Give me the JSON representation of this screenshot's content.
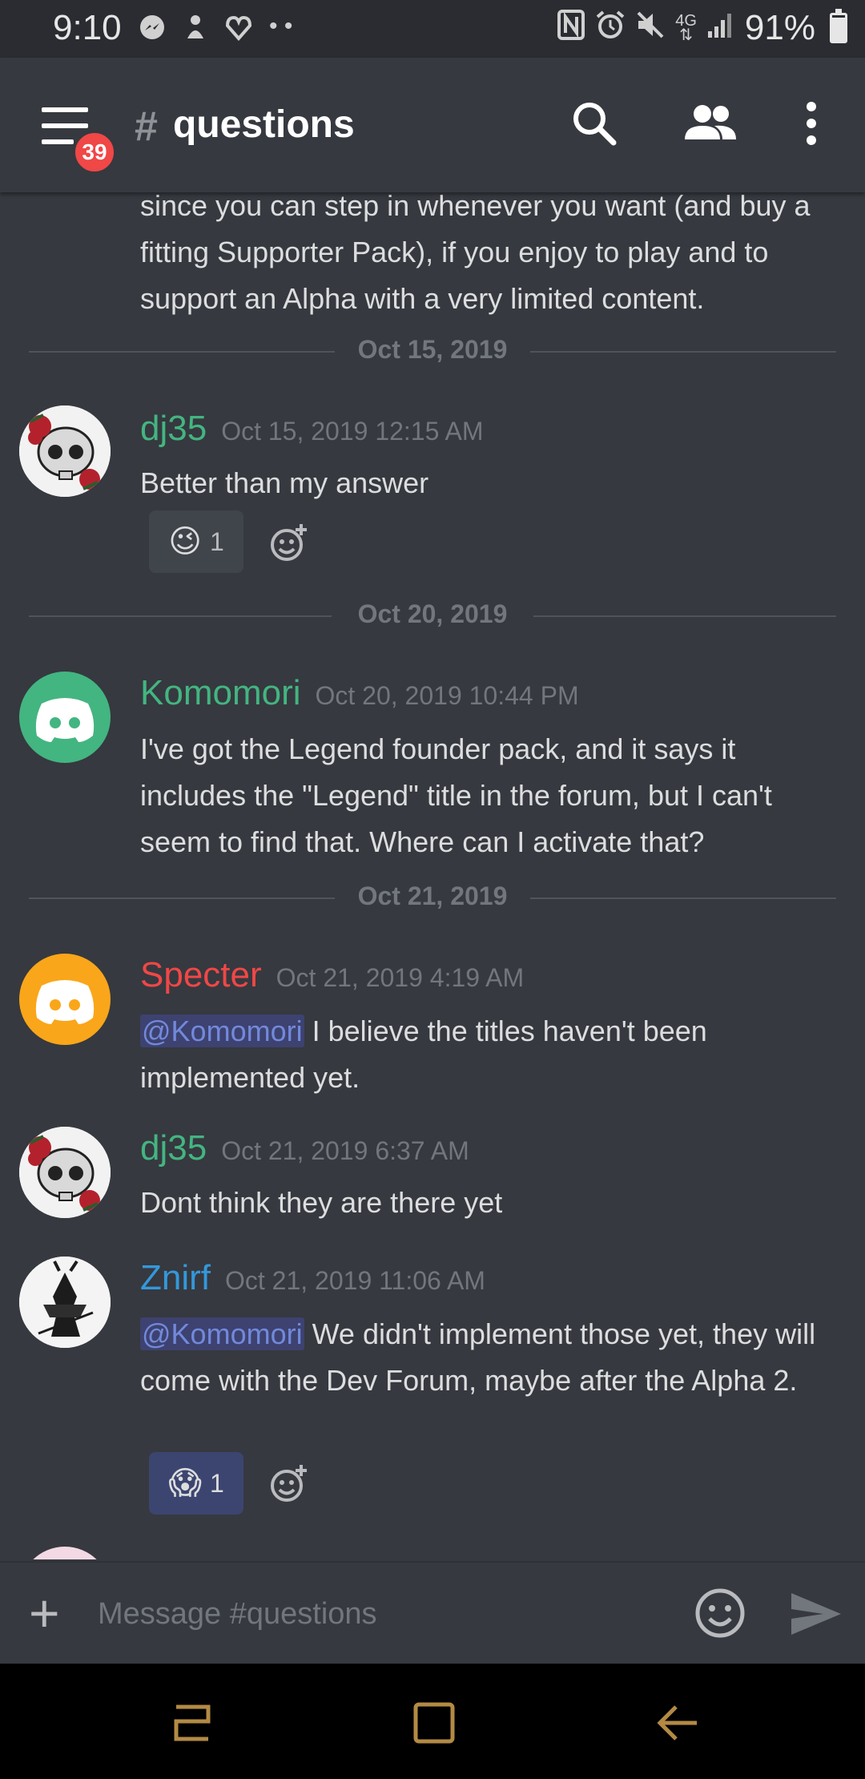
{
  "status_bar": {
    "time": "9:10",
    "left_icons": [
      "messenger-icon",
      "notification-icon",
      "health-icon",
      "more-dots-icon"
    ],
    "right_icons": [
      "nfc-icon",
      "alarm-icon",
      "mute-icon",
      "4g-icon",
      "signal-icon"
    ],
    "network": "4G",
    "battery_percent": "91%",
    "battery_level": 0.91
  },
  "header": {
    "unread_badge": "39",
    "hash": "#",
    "channel_name": "questions"
  },
  "messages": {
    "continuation_text": "since you can step in whenever you want (and buy a fitting Supporter Pack), if you enjoy to play and to support an Alpha with a very limited content.",
    "dividers": [
      "Oct 15, 2019",
      "Oct 20, 2019",
      "Oct 21, 2019"
    ],
    "m1": {
      "author": "dj35",
      "author_color": "#43b581",
      "timestamp": "Oct 15, 2019 12:15 AM",
      "text": "Better than my answer",
      "reaction_emoji": "😉",
      "reaction_count": "1"
    },
    "m2": {
      "author": "Komomori",
      "author_color": "#43b581",
      "timestamp": "Oct 20, 2019 10:44 PM",
      "text": "I've got the Legend founder pack, and it says it includes the \"Legend\" title in the forum, but I can't seem to find that. Where can I activate that?"
    },
    "m3": {
      "author": "Specter",
      "author_color": "#f04747",
      "timestamp": "Oct 21, 2019 4:19 AM",
      "mention": "@Komomori",
      "text": " I believe the titles haven't been implemented yet."
    },
    "m4": {
      "author": "dj35",
      "author_color": "#43b581",
      "timestamp": "Oct 21, 2019 6:37 AM",
      "text": "Dont think they are there yet"
    },
    "m5": {
      "author": "Znirf",
      "author_color": "#3498db",
      "timestamp": "Oct 21, 2019 11:06 AM",
      "mention": "@Komomori",
      "text": " We didn't implement those yet, they will come with the Dev Forum, maybe after the Alpha 2.",
      "reaction_emoji": "😱",
      "reaction_count": "1"
    }
  },
  "composer": {
    "placeholder": "Message #questions"
  },
  "colors": {
    "background": "#36393f",
    "blurple": "#7289da",
    "badge": "#f04747"
  }
}
